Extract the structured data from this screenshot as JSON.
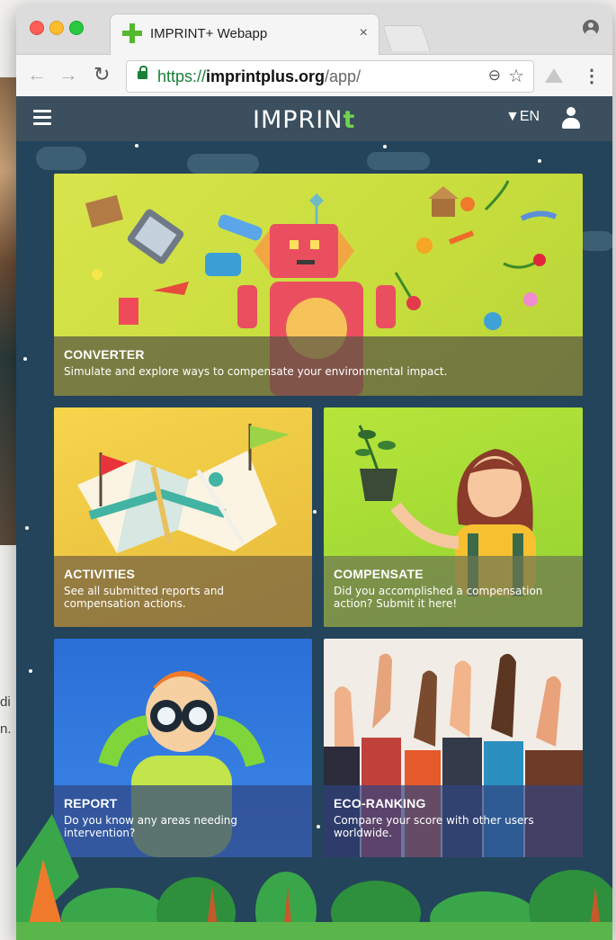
{
  "browser": {
    "tab_title": "IMPRINT+ Webapp",
    "tab_close": "×",
    "url_scheme": "https://",
    "url_host": "imprintplus.org",
    "url_path": "/app/",
    "nav_back": "←",
    "nav_forward": "→",
    "reload": "↻",
    "zoom": "⊖",
    "bookmark": "☆",
    "menu": "⋮"
  },
  "app": {
    "logo_text": "IMPRIN",
    "logo_plus": "t",
    "language": "▼EN"
  },
  "background_page": {
    "text_line_1": "di",
    "text_line_2": "n."
  },
  "cards": [
    {
      "title": "CONVERTER",
      "description": "Simulate and explore ways to compensate your environmental impact."
    },
    {
      "title": "ACTIVITIES",
      "description": "See all submitted reports and compensation actions."
    },
    {
      "title": "COMPENSATE",
      "description": "Did you accomplished a compensation action? Submit it here!"
    },
    {
      "title": "REPORT",
      "description": "Do you know any areas needing intervention?"
    },
    {
      "title": "ECO-RANKING",
      "description": "Compare your score with other users worldwide."
    }
  ],
  "colors": {
    "app_background": "#23445a",
    "app_bar": "#3b4f5e",
    "brand_green": "#70d44b",
    "url_green": "#188038"
  },
  "icons": {
    "menu": "hamburger-icon",
    "user": "user-icon",
    "secure": "lock-icon"
  }
}
